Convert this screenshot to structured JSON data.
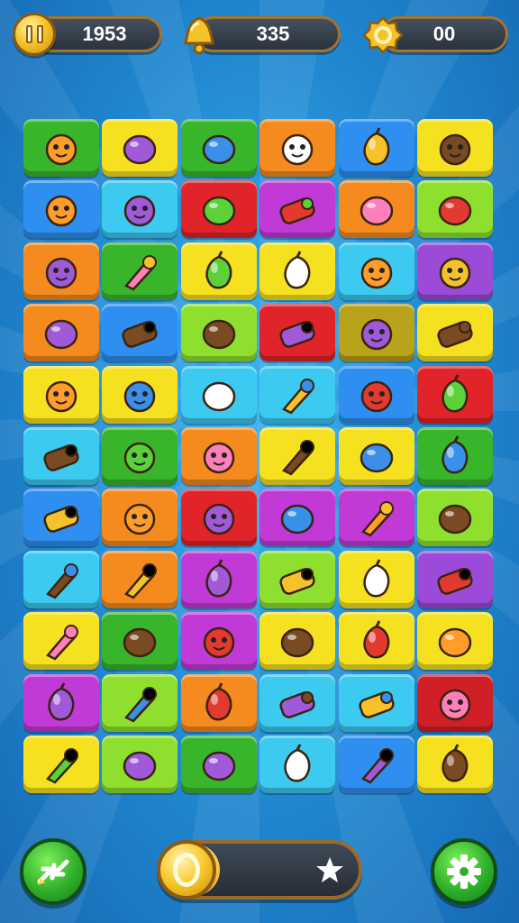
{
  "hud": {
    "pause_coin_value": "1953",
    "bell_value": "335",
    "ring_value": "00"
  },
  "colors": {
    "red": "#e0242a",
    "yellow": "#f5e11f",
    "green": "#39b52c",
    "orange": "#f58a1f",
    "blue": "#2f8ff0",
    "lime": "#8fe02e",
    "sky": "#3ccaf0",
    "magenta": "#c13ad6",
    "purple": "#9b4bd8",
    "olive": "#b9a21c",
    "darkred": "#d01f27"
  },
  "board": {
    "rows": [
      [
        [
          "green",
          "apple-icon"
        ],
        [
          "yellow",
          "skull-icon"
        ],
        [
          "green",
          "round-shield-icon"
        ],
        [
          "orange",
          "spyglass-icon"
        ],
        [
          "blue",
          "acorn-icon"
        ],
        [
          "yellow",
          "leaf-egg-icon"
        ]
      ],
      [
        [
          "blue",
          "log-icon"
        ],
        [
          "sky",
          "shovel-icon"
        ],
        [
          "red",
          "candy-roll-icon"
        ],
        [
          "magenta",
          "wrench-icon"
        ],
        [
          "orange",
          "bell-icon"
        ],
        [
          "lime",
          "dog-icon"
        ]
      ],
      [
        [
          "orange",
          "stump-icon"
        ],
        [
          "green",
          "magnifier-icon"
        ],
        [
          "yellow",
          "stick-icon"
        ],
        [
          "yellow",
          "lollipop-icon"
        ],
        [
          "sky",
          "key-icon"
        ],
        [
          "purple",
          "gem-icon"
        ]
      ],
      [
        [
          "orange",
          "gift-box-icon"
        ],
        [
          "blue",
          "mushroom-hammer-icon"
        ],
        [
          "lime",
          "orange-leaf-icon"
        ],
        [
          "red",
          "green-lolly-icon"
        ],
        [
          "olive",
          "frog-icon"
        ],
        [
          "yellow",
          "pickle-icon"
        ]
      ],
      [
        [
          "yellow",
          "log-icon"
        ],
        [
          "yellow",
          "blue-egg-icon"
        ],
        [
          "sky",
          "feather-icon"
        ],
        [
          "sky",
          "ghost-icon"
        ],
        [
          "blue",
          "bear-icon"
        ],
        [
          "red",
          "popsicle-icon"
        ]
      ],
      [
        [
          "sky",
          "totem-icon"
        ],
        [
          "green",
          "branch-icon"
        ],
        [
          "orange",
          "bundle-icon"
        ],
        [
          "yellow",
          "spiky-flower-icon"
        ],
        [
          "yellow",
          "green-ball-icon"
        ],
        [
          "green",
          "flower-icon"
        ]
      ],
      [
        [
          "blue",
          "pig-icon"
        ],
        [
          "orange",
          "apple-icon"
        ],
        [
          "red",
          "book-icon"
        ],
        [
          "magenta",
          "candy-icon"
        ],
        [
          "magenta",
          "bubble-icon"
        ],
        [
          "lime",
          "tv-icon"
        ]
      ],
      [
        [
          "sky",
          "ring-icon"
        ],
        [
          "orange",
          "peach-icon"
        ],
        [
          "magenta",
          "leaf-icon"
        ],
        [
          "lime",
          "mirror-icon"
        ],
        [
          "yellow",
          "chick-icon"
        ],
        [
          "purple",
          "cheese-icon"
        ]
      ],
      [
        [
          "yellow",
          "lemon-icon"
        ],
        [
          "green",
          "paint-icon"
        ],
        [
          "magenta",
          "bear-icon"
        ],
        [
          "yellow",
          "pink-blob-icon"
        ],
        [
          "yellow",
          "plum-icon"
        ],
        [
          "yellow",
          "pretzel-icon"
        ]
      ],
      [
        [
          "magenta",
          "cannon-icon"
        ],
        [
          "lime",
          "beetle-icon"
        ],
        [
          "orange",
          "berry-icon"
        ],
        [
          "sky",
          "bunny-icon"
        ],
        [
          "sky",
          "fox-icon"
        ],
        [
          "darkred",
          "teapot-icon"
        ]
      ],
      [
        [
          "yellow",
          "cat-icon"
        ],
        [
          "lime",
          "cactus-icon"
        ],
        [
          "green",
          "mushroom-icon"
        ],
        [
          "sky",
          "swirl-icon"
        ],
        [
          "blue",
          "bat-icon"
        ],
        [
          "yellow",
          "crate-icon"
        ]
      ]
    ]
  },
  "bottom": {
    "progress_fraction": 0.3
  }
}
